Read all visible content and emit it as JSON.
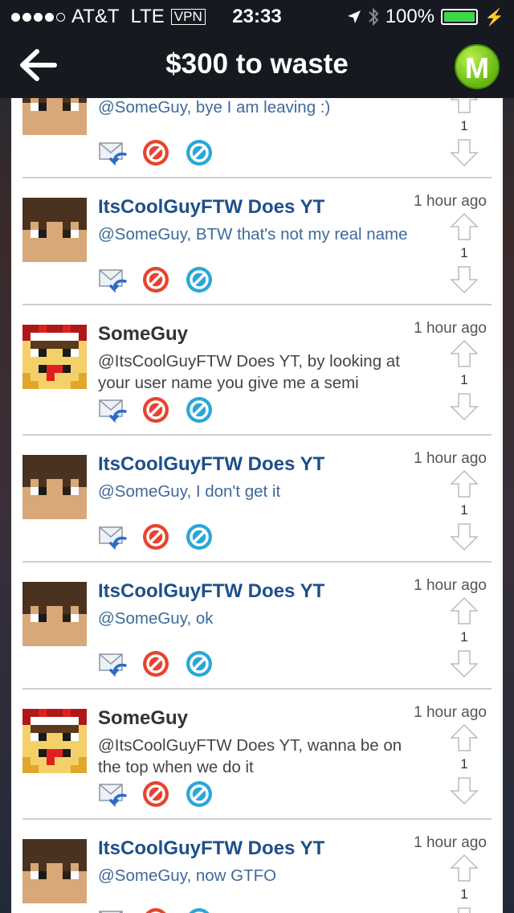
{
  "status_bar": {
    "carrier": "AT&T",
    "network": "LTE",
    "vpn": "VPN",
    "time": "23:33",
    "battery_percent": "100%",
    "battery_level": 1.0
  },
  "nav": {
    "title": "$300 to waste",
    "back_icon": "back-arrow-icon",
    "logo_letter": "M"
  },
  "comments": [
    {
      "name": "",
      "text": "@SomeGuy, bye I am leaving :)",
      "time": "",
      "votes": "1",
      "avatar": "brown"
    },
    {
      "name": "ItsCoolGuyFTW Does YT",
      "text": "@SomeGuy, BTW that's not my real name",
      "time": "1 hour ago",
      "votes": "1",
      "avatar": "brown"
    },
    {
      "name": "SomeGuy",
      "text": "@ItsCoolGuyFTW Does YT, by looking at your user name you give me a semi",
      "time": "1 hour ago",
      "votes": "1",
      "avatar": "red"
    },
    {
      "name": "ItsCoolGuyFTW Does YT",
      "text": "@SomeGuy, I don't get it",
      "time": "1 hour ago",
      "votes": "1",
      "avatar": "brown"
    },
    {
      "name": "ItsCoolGuyFTW Does YT",
      "text": "@SomeGuy, ok",
      "time": "1 hour ago",
      "votes": "1",
      "avatar": "brown"
    },
    {
      "name": "SomeGuy",
      "text": "@ItsCoolGuyFTW Does YT, wanna be on the top when we do it",
      "time": "1 hour ago",
      "votes": "1",
      "avatar": "red"
    },
    {
      "name": "ItsCoolGuyFTW Does YT",
      "text": "@SomeGuy, now GTFO",
      "time": "1 hour ago",
      "votes": "1",
      "avatar": "brown"
    }
  ],
  "icons": {
    "reply": "reply-mail-icon",
    "block": "block-red-icon",
    "report": "report-blue-icon",
    "upvote": "upvote-arrow-icon",
    "downvote": "downvote-arrow-icon"
  },
  "colors": {
    "name_blue": "#1e4f8a",
    "text_blue": "#3d6a9a",
    "block_red": "#e8432f",
    "report_blue": "#2aa7d8",
    "logo_green": "#66b712"
  }
}
